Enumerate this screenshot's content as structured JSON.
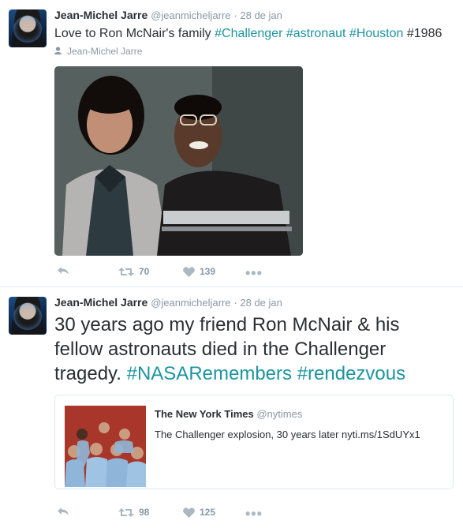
{
  "tweets": [
    {
      "author_name": "Jean-Michel Jarre",
      "author_handle": "@jeanmicheljarre",
      "time": "· 28 de jan",
      "text_parts": {
        "t1": "Love to Ron McNair's family ",
        "h1": "#Challenger",
        "h2": "#astronaut",
        "h3": "#Houston",
        "t2": " #1986"
      },
      "pinned_label": "Jean-Michel Jarre",
      "retweets": "70",
      "likes": "139"
    },
    {
      "author_name": "Jean-Michel Jarre",
      "author_handle": "@jeanmicheljarre",
      "time": "· 28 de jan",
      "text_parts": {
        "t1": "30 years ago my friend Ron McNair & his fellow astronauts died in the Challenger tragedy. ",
        "h1": "#NASARemembers",
        "h2": "#rendezvous"
      },
      "quote": {
        "name": "The New York Times",
        "handle": "@nytimes",
        "text": "The Challenger explosion, 30 years later nyti.ms/1SdUYx1"
      },
      "retweets": "98",
      "likes": "125"
    }
  ],
  "colors": {
    "hashtag": "#1b95a0",
    "muted": "#8899a6",
    "text": "#292f33",
    "divider": "#e1e8ed"
  },
  "icons": [
    "reply-icon",
    "retweet-icon",
    "heart-icon",
    "more-icon",
    "person-icon"
  ]
}
